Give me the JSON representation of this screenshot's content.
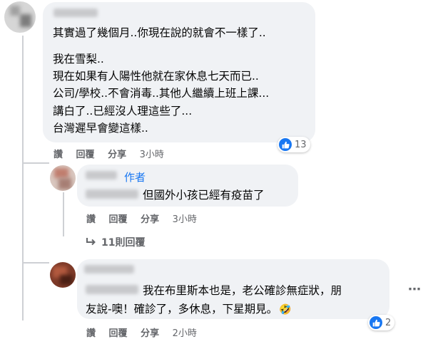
{
  "comment1": {
    "lines": [
      "其實過了幾個月..你現在說的就會不一樣了..",
      "我在雪梨..",
      "現在如果有人陽性他就在家休息七天而已..",
      "公司/學校..不會消毒..其他人繼續上班上課...",
      "講白了..已經沒人理這些了...",
      "台灣遲早會變這樣.."
    ],
    "actions": {
      "like": "讚",
      "reply": "回覆",
      "share": "分享",
      "time": "3小時"
    },
    "reaction_count": "13"
  },
  "reply1": {
    "author_badge": "作者",
    "text": "但國外小孩已經有疫苗了",
    "actions": {
      "like": "讚",
      "reply": "回覆",
      "share": "分享",
      "time": "3小時"
    }
  },
  "more_replies": {
    "label": "11則回覆"
  },
  "reply2": {
    "line1": "我在布里斯本也是，老公確診無症狀，朋",
    "line2": "友說-噢！確診了，多休息，下星期見。",
    "emoji": "🤣",
    "actions": {
      "like": "讚",
      "reply": "回覆",
      "share": "分享",
      "time": "2小時"
    },
    "reaction_count": "2"
  },
  "colors": {
    "bubble": "#f0f2f5",
    "meta": "#65676b",
    "like": "#1877f2",
    "author_badge": "#1877f2"
  }
}
